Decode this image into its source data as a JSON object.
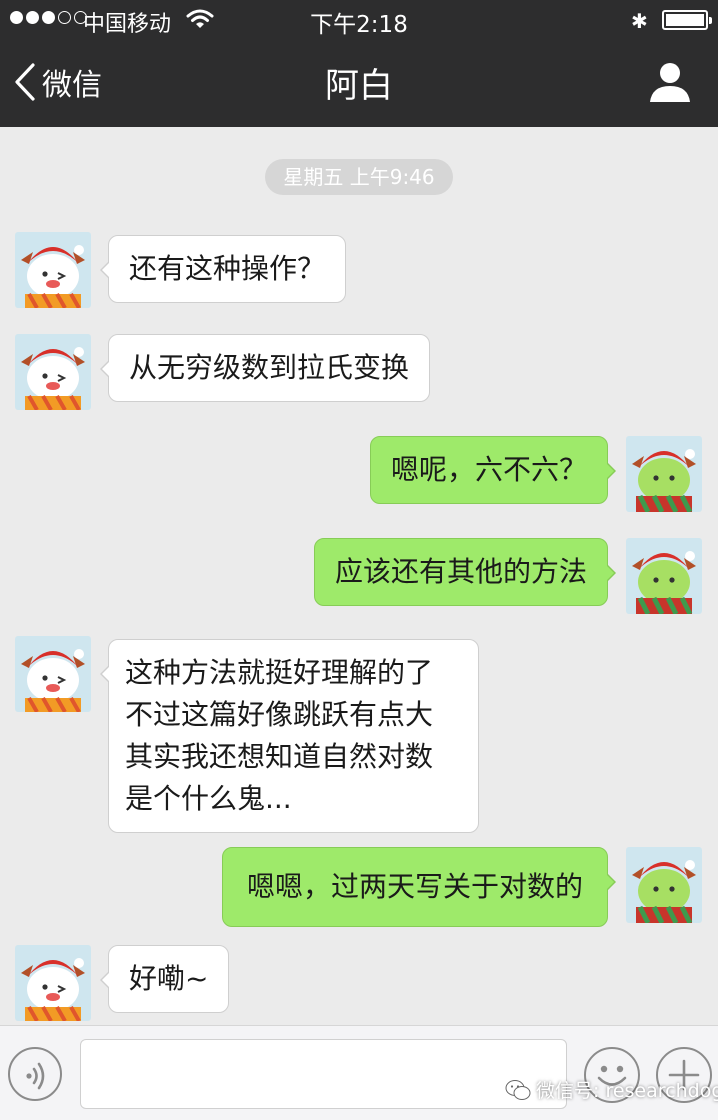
{
  "status_bar": {
    "carrier": "中国移动",
    "time": "下午2:18",
    "signal_dots_filled": 3,
    "signal_dots_total": 5,
    "battery_level": 1.0
  },
  "nav": {
    "back_label": "微信",
    "title": "阿白"
  },
  "chat": {
    "timestamp": "星期五 上午9:46",
    "messages": [
      {
        "side": "left",
        "text": "还有这种操作？"
      },
      {
        "side": "left",
        "text": "从无穷级数到拉氏变换"
      },
      {
        "side": "right",
        "text": "嗯呢，六不六？"
      },
      {
        "side": "right",
        "text": "应该还有其他的方法"
      },
      {
        "side": "left",
        "text": "这种方法就挺好理解的了\n不过这篇好像跳跃有点大\n其实我还想知道自然对数\n是个什么鬼..."
      },
      {
        "side": "right",
        "text": "嗯嗯，过两天写关于对数的"
      },
      {
        "side": "left",
        "text": "好嘞~"
      }
    ]
  },
  "input_bar": {
    "watermark": "微信号: researchdog"
  },
  "colors": {
    "topbar": "#2d2d2e",
    "chat_background": "#ebebeb",
    "bubble_sent": "#9eea6a",
    "bubble_received": "#ffffff"
  },
  "icons": {
    "back": "chevron-left-icon",
    "profile": "person-icon",
    "voice": "voice-icon",
    "emoji": "smiley-icon",
    "plus": "plus-icon",
    "watermark": "wechat-logo-icon"
  }
}
